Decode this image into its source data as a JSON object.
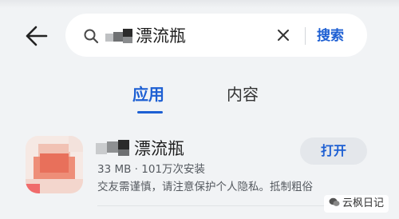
{
  "search": {
    "query": "漂流瓶",
    "submit_label": "搜索"
  },
  "tabs": [
    {
      "label": "应用",
      "active": true
    },
    {
      "label": "内容",
      "active": false
    }
  ],
  "result": {
    "name": "漂流瓶",
    "meta": "33 MB · 101万次安装",
    "description": "交友需谨慎，请注意保护个人隐私。抵制粗俗",
    "action_label": "打开"
  },
  "watermark": {
    "label": "云枫日记"
  },
  "icons": {
    "back": "arrow-left-icon",
    "search": "search-icon",
    "clear": "close-icon",
    "watermark": "wechat-icon"
  },
  "colors": {
    "accent": "#1d5fd3",
    "background": "#f1f3f5"
  }
}
